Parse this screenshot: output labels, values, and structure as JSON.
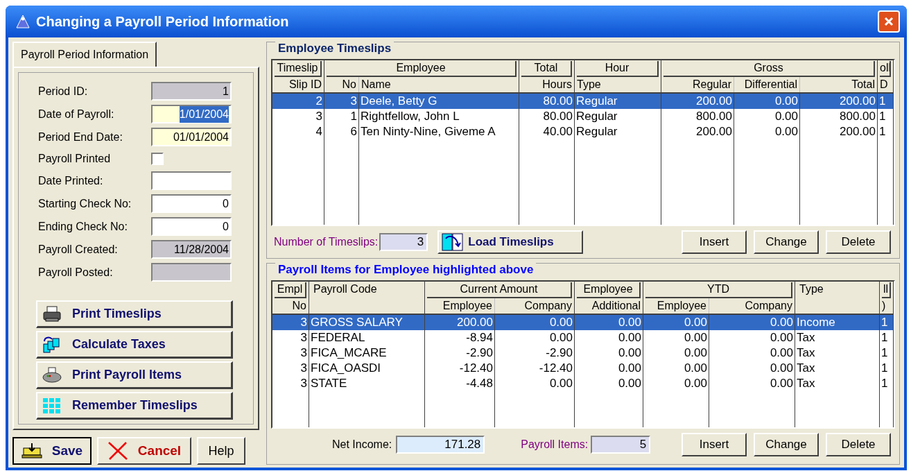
{
  "window": {
    "title": "Changing a Payroll Period Information"
  },
  "tabs": [
    {
      "label": "Payroll Period Information",
      "selected": true
    }
  ],
  "fields": [
    {
      "label": "Period ID:",
      "kind": "readonly",
      "value": "1",
      "highlighted": false
    },
    {
      "label": "Date of Payroll:",
      "kind": "date",
      "value": "1/01/2004",
      "highlighted": true
    },
    {
      "label": "Period End Date:",
      "kind": "date",
      "value": "01/01/2004",
      "highlighted": false
    },
    {
      "label": "Payroll Printed",
      "kind": "checkbox",
      "checked": false
    },
    {
      "label": "Date Printed:",
      "kind": "text"
    },
    {
      "label": "Starting Check No:",
      "kind": "text",
      "value": "0",
      "highlighted": false
    },
    {
      "label": "Ending Check No:",
      "kind": "text",
      "value": "0",
      "highlighted": false
    },
    {
      "label": "Payroll Created:",
      "kind": "readonly",
      "value": "11/28/2004",
      "highlighted": false
    },
    {
      "label": "Payroll Posted:",
      "kind": "readonly"
    }
  ],
  "actions": [
    {
      "label": "Print Timeslips",
      "kind": "print"
    },
    {
      "label": "Calculate Taxes",
      "kind": "calculate"
    },
    {
      "label": "Print Payroll Items",
      "kind": "report"
    },
    {
      "label": "Remember Timeslips",
      "kind": "remember"
    }
  ],
  "footer_buttons": [
    {
      "label": "Save",
      "kind": "save"
    },
    {
      "label": "Cancel",
      "kind": "cancel"
    },
    {
      "label": "Help",
      "kind": "plain"
    }
  ],
  "timeslips": {
    "title": "Employee Timeslips",
    "header_groups": [
      "Timeslip",
      "Employee",
      "Total",
      "Hour",
      "Gross",
      "oll"
    ],
    "columns": [
      {
        "label": "Slip ID",
        "kind": "number"
      },
      {
        "label": "No",
        "kind": "number"
      },
      {
        "label": "Name",
        "kind": "text"
      },
      {
        "label": "Hours",
        "kind": "number"
      },
      {
        "label": "Type",
        "kind": "text"
      },
      {
        "label": "Regular",
        "kind": "number"
      },
      {
        "label": "Differential",
        "kind": "number"
      },
      {
        "label": "Total",
        "kind": "number"
      },
      {
        "label": "D",
        "kind": "text"
      }
    ],
    "rows": [
      {
        "selected": true,
        "cells": [
          "2",
          "3",
          "Deele, Betty G",
          "80.00",
          "Regular",
          "200.00",
          "0.00",
          "200.00",
          "1"
        ]
      },
      {
        "selected": false,
        "cells": [
          "3",
          "1",
          "Rightfellow, John L",
          "80.00",
          "Regular",
          "800.00",
          "0.00",
          "800.00",
          "1"
        ]
      },
      {
        "selected": false,
        "cells": [
          "4",
          "6",
          "Ten Ninty-Nine, Giveme A",
          "40.00",
          "Regular",
          "200.00",
          "0.00",
          "200.00",
          "1"
        ]
      }
    ],
    "count_label": "Number of Timeslips:",
    "count": "3",
    "load_button": "Load Timeslips",
    "buttons": [
      "Insert",
      "Change",
      "Delete"
    ]
  },
  "payroll_items": {
    "title": "Payroll Items for Employee highlighted above",
    "header_groups": [
      "Empl",
      "Payroll Code",
      "Current Amount",
      "Employee",
      "YTD",
      "Type",
      "ll"
    ],
    "columns": [
      {
        "label": "No",
        "kind": "number"
      },
      {
        "kind": "text"
      },
      {
        "label": "Employee",
        "kind": "number"
      },
      {
        "label": "Company",
        "kind": "number"
      },
      {
        "label": "Additional",
        "kind": "number"
      },
      {
        "label": "Employee",
        "kind": "number"
      },
      {
        "label": "Company",
        "kind": "number"
      },
      {
        "kind": "text"
      },
      {
        "label": ")",
        "kind": "text"
      }
    ],
    "rows": [
      {
        "selected": true,
        "cells": [
          "3",
          "GROSS SALARY",
          "200.00",
          "0.00",
          "0.00",
          "0.00",
          "0.00",
          "Income",
          "1"
        ]
      },
      {
        "selected": false,
        "cells": [
          "3",
          "FEDERAL",
          "-8.94",
          "0.00",
          "0.00",
          "0.00",
          "0.00",
          "Tax",
          "1"
        ]
      },
      {
        "selected": false,
        "cells": [
          "3",
          "FICA_MCARE",
          "-2.90",
          "-2.90",
          "0.00",
          "0.00",
          "0.00",
          "Tax",
          "1"
        ]
      },
      {
        "selected": false,
        "cells": [
          "3",
          "FICA_OASDI",
          "-12.40",
          "-12.40",
          "0.00",
          "0.00",
          "0.00",
          "Tax",
          "1"
        ]
      },
      {
        "selected": false,
        "cells": [
          "3",
          "STATE",
          "-4.48",
          "0.00",
          "0.00",
          "0.00",
          "0.00",
          "Tax",
          "1"
        ]
      }
    ],
    "net_label": "Net Income:",
    "net_value": "171.28",
    "count_label": "Payroll Items:",
    "count": "5",
    "buttons": [
      "Insert",
      "Change",
      "Delete"
    ]
  }
}
